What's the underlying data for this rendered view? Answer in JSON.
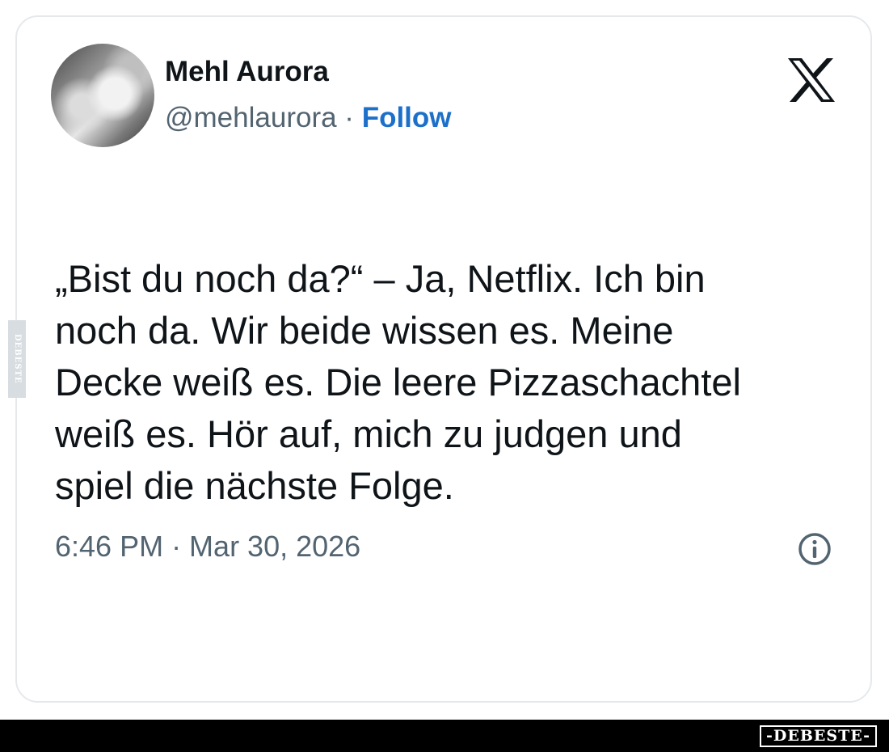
{
  "post": {
    "author_name": "Mehl Aurora",
    "handle": "@mehlaurora",
    "separator": " · ",
    "follow_label": "Follow",
    "text": "„Bist du noch da?“ – Ja, Netflix. Ich bin\nnoch da. Wir beide wissen es. Meine\nDecke weiß es. Die leere Pizzaschachtel\nweiß es. Hör auf, mich zu judgen und\nspiel die nächste Folge.",
    "timestamp": "6:46 PM · Mar 30, 2026",
    "platform_icon": "x-logo-icon",
    "info_icon": "info-icon"
  },
  "watermark": {
    "side_label": "DEBESTE",
    "brand": "-DEBESTE-"
  },
  "colors": {
    "text": "#0f1419",
    "secondary": "#536471",
    "follow": "#1d70c9",
    "border": "#e6e9ec",
    "bar": "#000000"
  }
}
